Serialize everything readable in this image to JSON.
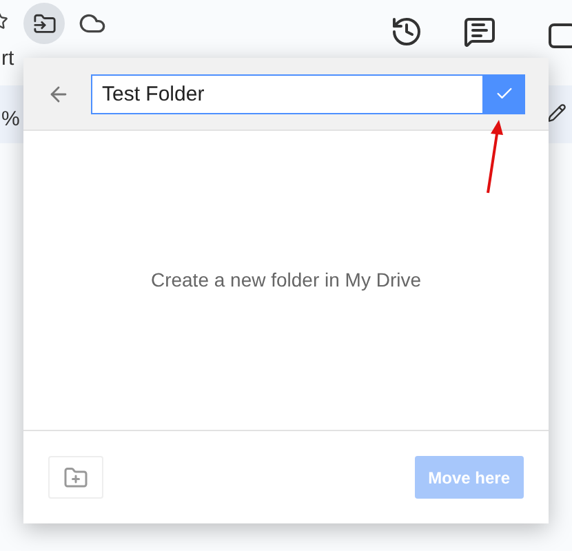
{
  "menu_fragment": "rt",
  "zoom_fragment": "%",
  "dialog": {
    "folder_name": {
      "value": "Test Folder"
    },
    "message": "Create a new folder in My Drive",
    "move_button": {
      "label": "Move here",
      "disabled": true
    }
  }
}
